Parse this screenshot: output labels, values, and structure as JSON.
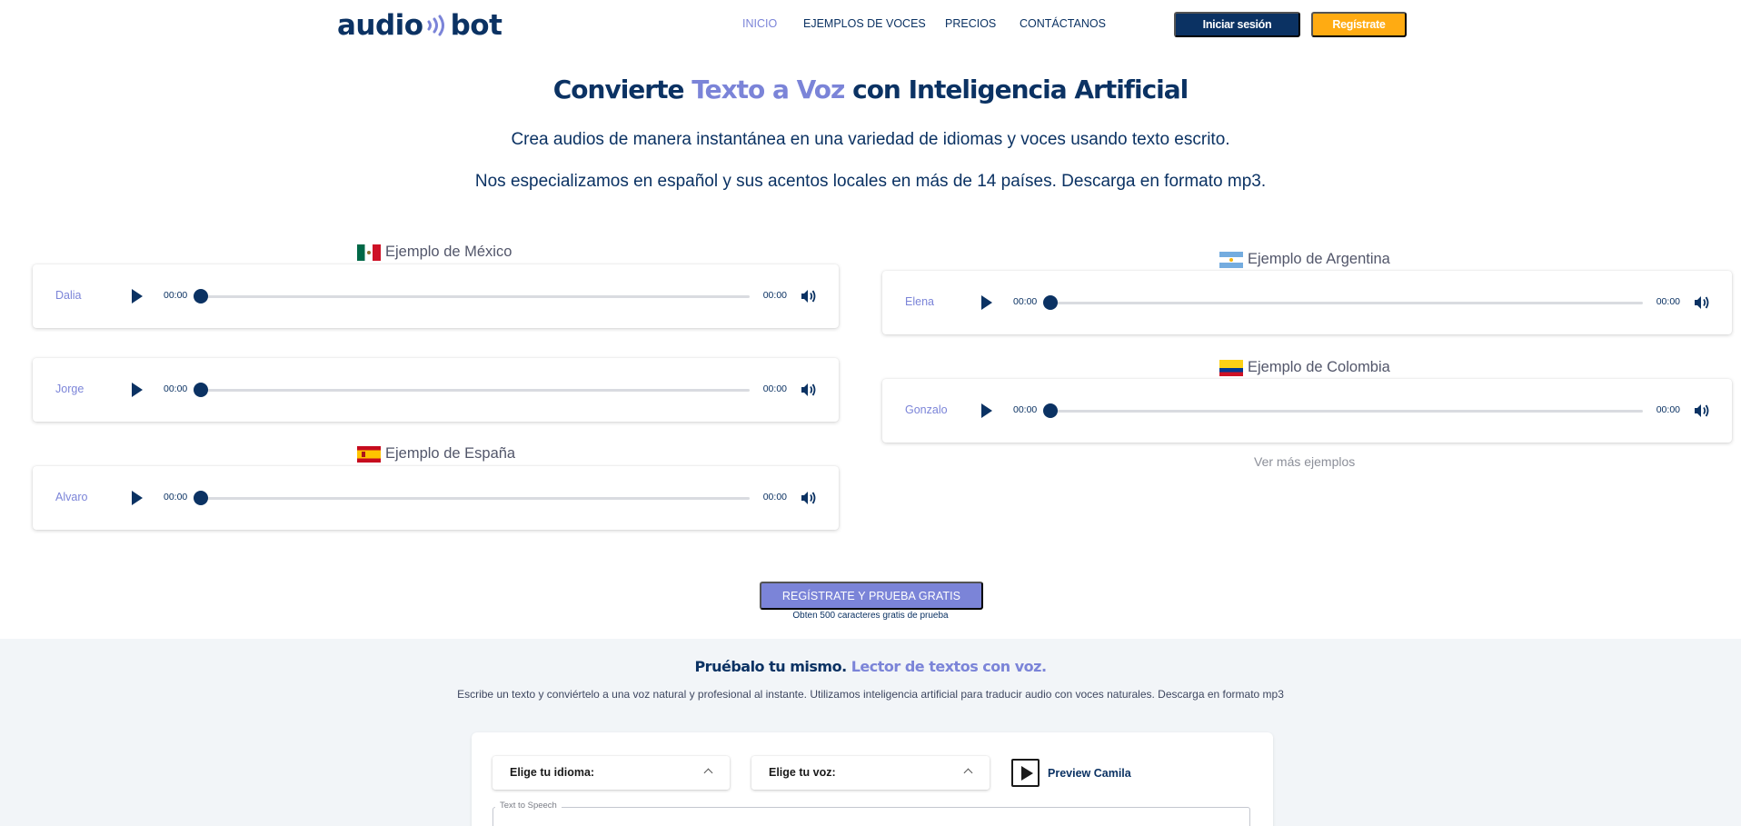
{
  "header": {
    "logo_left": "audio",
    "logo_right": "bot",
    "nav": [
      {
        "label": "INICIO",
        "active": true
      },
      {
        "label": "EJEMPLOS DE VOCES",
        "active": false
      },
      {
        "label": "PRECIOS",
        "active": false
      },
      {
        "label": "CONTÁCTANOS",
        "active": false
      }
    ],
    "login_label": "Iniciar sesión",
    "register_label": "Regístrate"
  },
  "hero": {
    "title_pre": "Convierte ",
    "title_accent": "Texto a Voz",
    "title_post": " con Inteligencia Artificial",
    "subtitle1": "Crea audios de manera instantánea en una variedad de idiomas y voces usando texto escrito.",
    "subtitle2": "Nos especializamos en español y sus acentos locales en más de 14 países. Descarga en formato mp3."
  },
  "examples": {
    "mexico": {
      "label": "Ejemplo de México",
      "flag": "mexico-flag-icon"
    },
    "spain": {
      "label": "Ejemplo de España",
      "flag": "spain-flag-icon"
    },
    "argentina": {
      "label": "Ejemplo de Argentina",
      "flag": "argentina-flag-icon"
    },
    "colombia": {
      "label": "Ejemplo de Colombia",
      "flag": "colombia-flag-icon"
    },
    "players": [
      {
        "name": "Dalia",
        "current": "00:00",
        "duration": "00:00",
        "progress": 0
      },
      {
        "name": "Jorge",
        "current": "00:00",
        "duration": "00:00",
        "progress": 0
      },
      {
        "name": "Alvaro",
        "current": "00:00",
        "duration": "00:00",
        "progress": 0
      },
      {
        "name": "Elena",
        "current": "00:00",
        "duration": "00:00",
        "progress": 0
      },
      {
        "name": "Gonzalo",
        "current": "00:00",
        "duration": "00:00",
        "progress": 0
      }
    ],
    "more_label": "Ver más ejemplos"
  },
  "cta": {
    "button_label": "REGÍSTRATE Y PRUEBA GRATIS",
    "note": "Obten 500 caracteres gratis de prueba"
  },
  "try": {
    "title_pre": "Pruébalo tu mismo. ",
    "title_accent": "Lector de textos con voz.",
    "description": "Escribe un texto y conviértelo a una voz natural y profesional al instante. Utilizamos inteligencia artificial para traducir audio con voces naturales. Descarga en formato mp3",
    "language_label": "Elige tu idioma:",
    "voice_label": "Elige tu voz:",
    "preview_label": "Preview Camila",
    "textarea_legend": "Text to Speech"
  },
  "colors": {
    "brand_navy": "#0b3263",
    "accent_purple": "#7b84d8",
    "accent_orange": "#ffab12",
    "section_bg": "#f2f5f8"
  }
}
